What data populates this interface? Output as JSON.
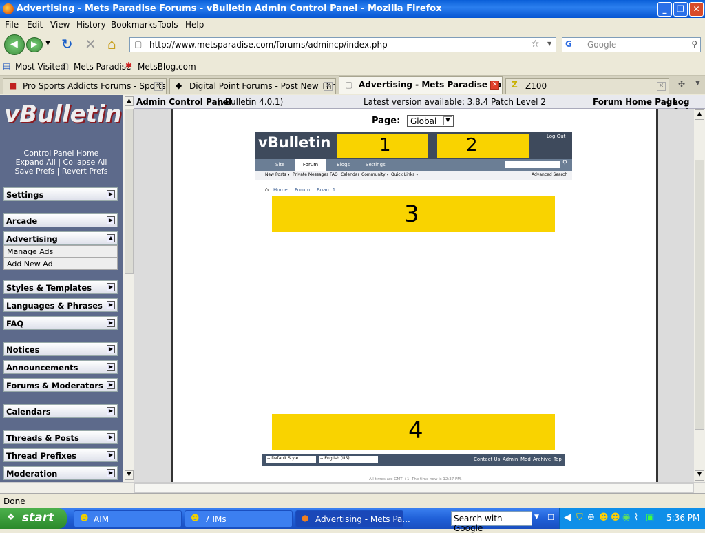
{
  "window": {
    "title": "Advertising - Mets Paradise Forums - vBulletin Admin Control Panel - Mozilla Firefox"
  },
  "menu": [
    "File",
    "Edit",
    "View",
    "History",
    "Bookmarks",
    "Tools",
    "Help"
  ],
  "url": "http://www.metsparadise.com/forums/admincp/index.php",
  "search_placeholder": "Google",
  "bookmarks": [
    "Most Visited",
    "Mets Paradise",
    "MetsBlog.com"
  ],
  "tabs": [
    "Pro Sports Addicts Forums - Sports Di...",
    "Digital Point Forums - Post New Thread",
    "Advertising - Mets Paradise For...",
    "Z100"
  ],
  "sidebar": {
    "logo": "vBulletin",
    "links": [
      "Control Panel Home",
      "Expand All | Collapse All",
      "Save Prefs | Revert Prefs"
    ],
    "groups": [
      "Settings",
      "Arcade",
      "Advertising",
      "Styles & Templates",
      "Languages & Phrases",
      "FAQ",
      "Notices",
      "Announcements",
      "Forums & Moderators",
      "Calendars",
      "Threads & Posts",
      "Thread Prefixes",
      "Moderation"
    ],
    "subitems": [
      "Manage Ads",
      "Add New Ad"
    ]
  },
  "header": {
    "title": "Admin Control Panel",
    "version": "(vBulletin 4.0.1)",
    "latest": "Latest version available: 3.8.4 Patch Level 2",
    "home": "Forum Home Page",
    "logout": "Log Out",
    "sep": "|"
  },
  "page_select": {
    "label": "Page:",
    "value": "Global"
  },
  "preview": {
    "logo": "vBulletin",
    "logout": "Log Out",
    "tabs": [
      "Site",
      "Forum",
      "Blogs",
      "Settings"
    ],
    "subnav": [
      "New Posts ▾",
      "Private Messages",
      "FAQ",
      "Calendar",
      "Community ▾",
      "Quick Links ▾"
    ],
    "advanced": "Advanced Search",
    "breadcrumb": [
      "Home",
      "Forum",
      "Board 1"
    ],
    "ads": [
      "1",
      "2",
      "3",
      "4"
    ],
    "style_select": "-- Default Style",
    "lang_select": "-- English (US)",
    "footer_links": [
      "Contact Us",
      "Admin",
      "Mod",
      "Archive",
      "Top"
    ],
    "timeline": "All times are GMT +1. The time now is 12:37 PM."
  },
  "status": "Done",
  "taskbar": {
    "start": "start",
    "tasks": [
      "AIM",
      "7 IMs",
      "Advertising - Mets Pa..."
    ],
    "search": "Search with Google",
    "clock": "5:36 PM"
  }
}
